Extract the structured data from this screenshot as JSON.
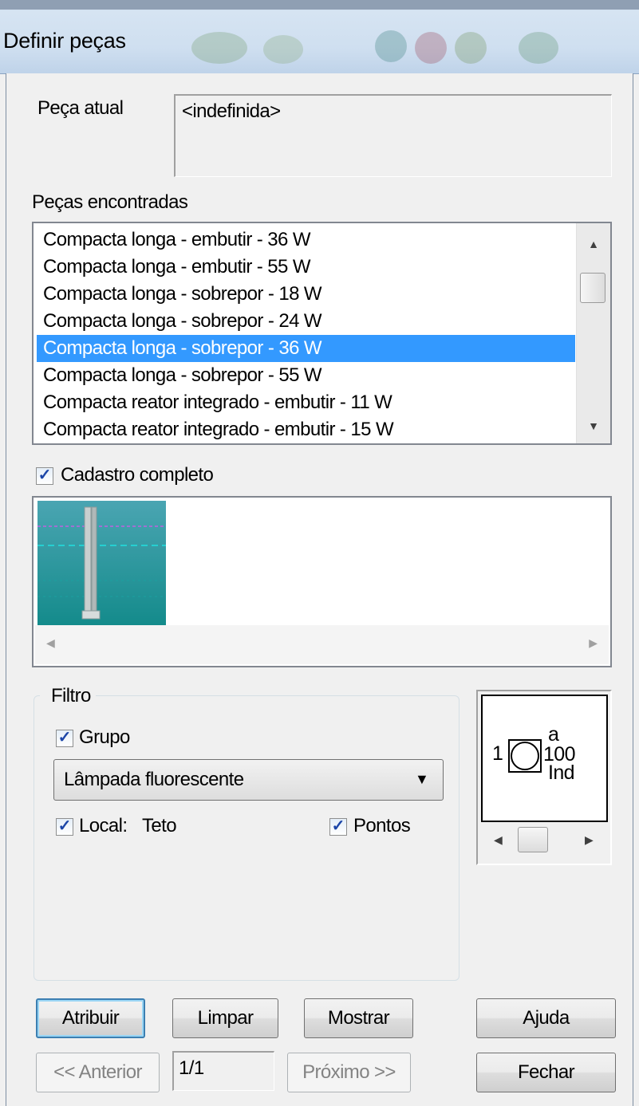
{
  "window": {
    "title": "Definir peças"
  },
  "current_piece": {
    "label": "Peça atual",
    "value": "<indefinida>"
  },
  "found_pieces": {
    "label": "Peças encontradas",
    "items": [
      "Compacta longa - embutir - 36 W",
      "Compacta longa - embutir - 55 W",
      "Compacta longa - sobrepor - 18 W",
      "Compacta longa - sobrepor - 24 W",
      "Compacta longa - sobrepor - 36 W",
      "Compacta longa - sobrepor - 55 W",
      "Compacta reator integrado - embutir - 11 W",
      "Compacta reator integrado - embutir - 15 W"
    ],
    "selected_index": 4
  },
  "full_catalog": {
    "label": "Cadastro completo",
    "checked": true
  },
  "filter": {
    "title": "Filtro",
    "group_checkbox": {
      "label": "Grupo",
      "checked": true
    },
    "group_value": "Lâmpada fluorescente",
    "local_checkbox": {
      "label": "Local:",
      "value": "Teto",
      "checked": true
    },
    "points_checkbox": {
      "label": "Pontos",
      "checked": true
    }
  },
  "symbol": {
    "left": "1",
    "top": "a",
    "middle": "100",
    "bottom": "Ind"
  },
  "buttons": {
    "assign": "Atribuir",
    "clear": "Limpar",
    "show": "Mostrar",
    "help": "Ajuda",
    "previous": "<< Anterior",
    "next": "Próximo >>",
    "close": "Fechar"
  },
  "page_indicator": "1/1",
  "colors": {
    "selection": "#3399ff",
    "dialog_bg": "#f0f0f0",
    "checkmark": "#1b45a8"
  }
}
